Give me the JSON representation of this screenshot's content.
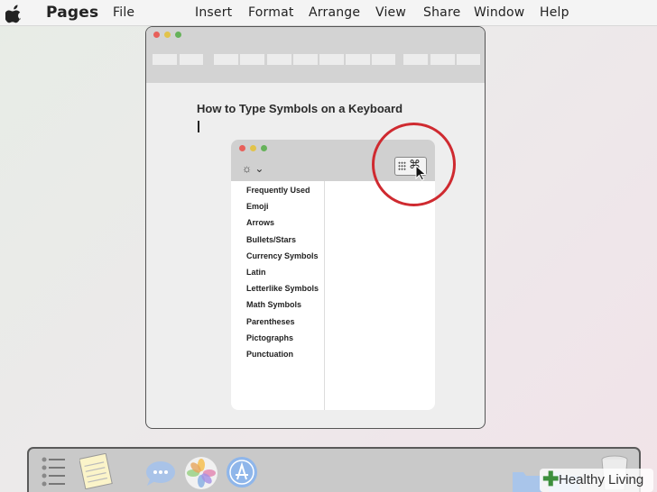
{
  "menubar": {
    "app_name": "Pages",
    "menus": [
      "File",
      "Insert",
      "Format",
      "Arrange",
      "View",
      "Share",
      "Window",
      "Help"
    ]
  },
  "document": {
    "title": "How to Type Symbols on a Keyboard"
  },
  "character_viewer": {
    "settings_icon": "gear-icon",
    "toggle_icon": "keyboard-command-icon",
    "categories": [
      "Frequently Used",
      "Emoji",
      "Arrows",
      "Bullets/Stars",
      "Currency Symbols",
      "Latin",
      "Letterlike Symbols",
      "Math Symbols",
      "Parentheses",
      "Pictographs",
      "Punctuation"
    ]
  },
  "dock": {
    "icons": [
      "reminders-icon",
      "notes-icon",
      "messages-icon",
      "photos-icon",
      "app-store-icon",
      "folder-icon",
      "trash-icon"
    ]
  },
  "watermark": {
    "text": "Healthy Living"
  },
  "colors": {
    "highlight_circle": "#cf2a30",
    "close": "#e8605a",
    "minimize": "#e2c34a",
    "zoom": "#66b25a"
  }
}
